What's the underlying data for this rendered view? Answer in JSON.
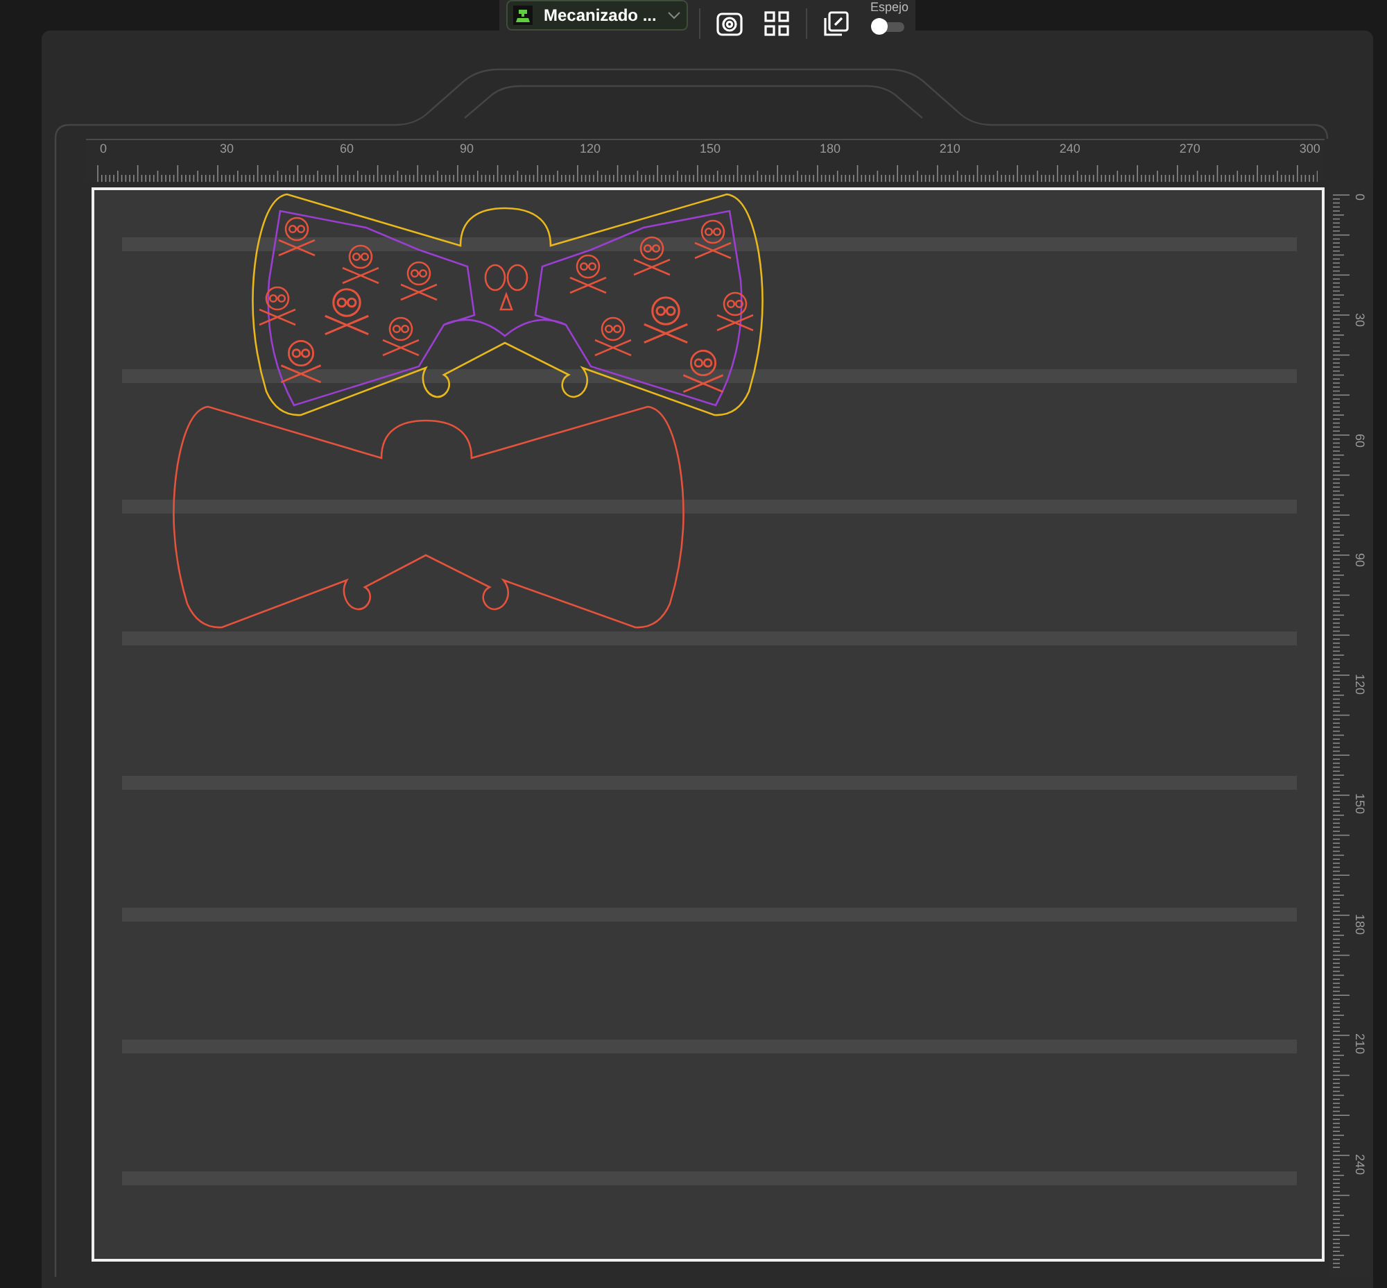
{
  "toolbar": {
    "machine_select": {
      "value": "Mecanizado ..."
    },
    "mirror": {
      "label": "Espejo",
      "on": false
    }
  },
  "rulers": {
    "top": {
      "labels": [
        "0",
        "30",
        "60",
        "90",
        "120",
        "150",
        "180",
        "210",
        "240",
        "270",
        "300"
      ]
    },
    "right": {
      "labels": [
        "0",
        "30",
        "60",
        "90",
        "120",
        "150",
        "180",
        "210",
        "240"
      ]
    }
  }
}
